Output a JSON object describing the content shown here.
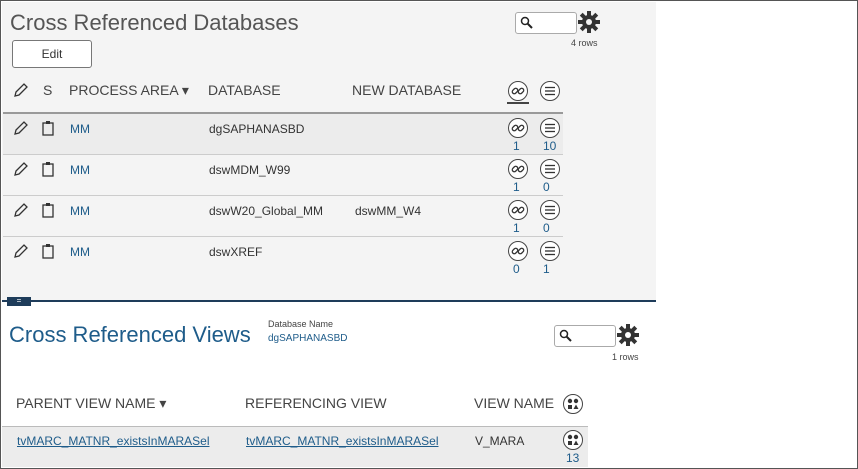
{
  "top": {
    "title": "Cross Referenced Databases",
    "edit_label": "Edit",
    "rows_label": "4 rows",
    "columns": {
      "s": "S",
      "process_area": "PROCESS AREA ▾",
      "database": "DATABASE",
      "new_database": "NEW DATABASE"
    },
    "rows": [
      {
        "process_area": "MM",
        "database": "dgSAPHANASBD",
        "new_database": "",
        "link_count": "1",
        "list_count": "10",
        "selected": true
      },
      {
        "process_area": "MM",
        "database": "dswMDM_W99",
        "new_database": "",
        "link_count": "1",
        "list_count": "0",
        "selected": false
      },
      {
        "process_area": "MM",
        "database": "dswW20_Global_MM",
        "new_database": "dswMM_W4",
        "link_count": "1",
        "list_count": "0",
        "selected": false
      },
      {
        "process_area": "MM",
        "database": "dswXREF",
        "new_database": "",
        "link_count": "0",
        "list_count": "1",
        "selected": false
      }
    ]
  },
  "splitter_label": "=",
  "bottom": {
    "title": "Cross Referenced Views",
    "db_name_label": "Database Name",
    "db_name_value": "dgSAPHANASBD",
    "rows_label": "1 rows",
    "columns": {
      "parent_view": "PARENT VIEW NAME ▾",
      "referencing_view": "REFERENCING VIEW",
      "view_name": "VIEW NAME"
    },
    "rows": [
      {
        "parent_view": "tvMARC_MATNR_existsInMARASel",
        "referencing_view": "tvMARC_MATNR_existsInMARASel",
        "view_name": "V_MARA",
        "count": "13"
      }
    ]
  },
  "colors": {
    "accent": "#1e5c8a",
    "panel_bg": "#f4f4f4",
    "splitter": "#1e3c5a"
  }
}
